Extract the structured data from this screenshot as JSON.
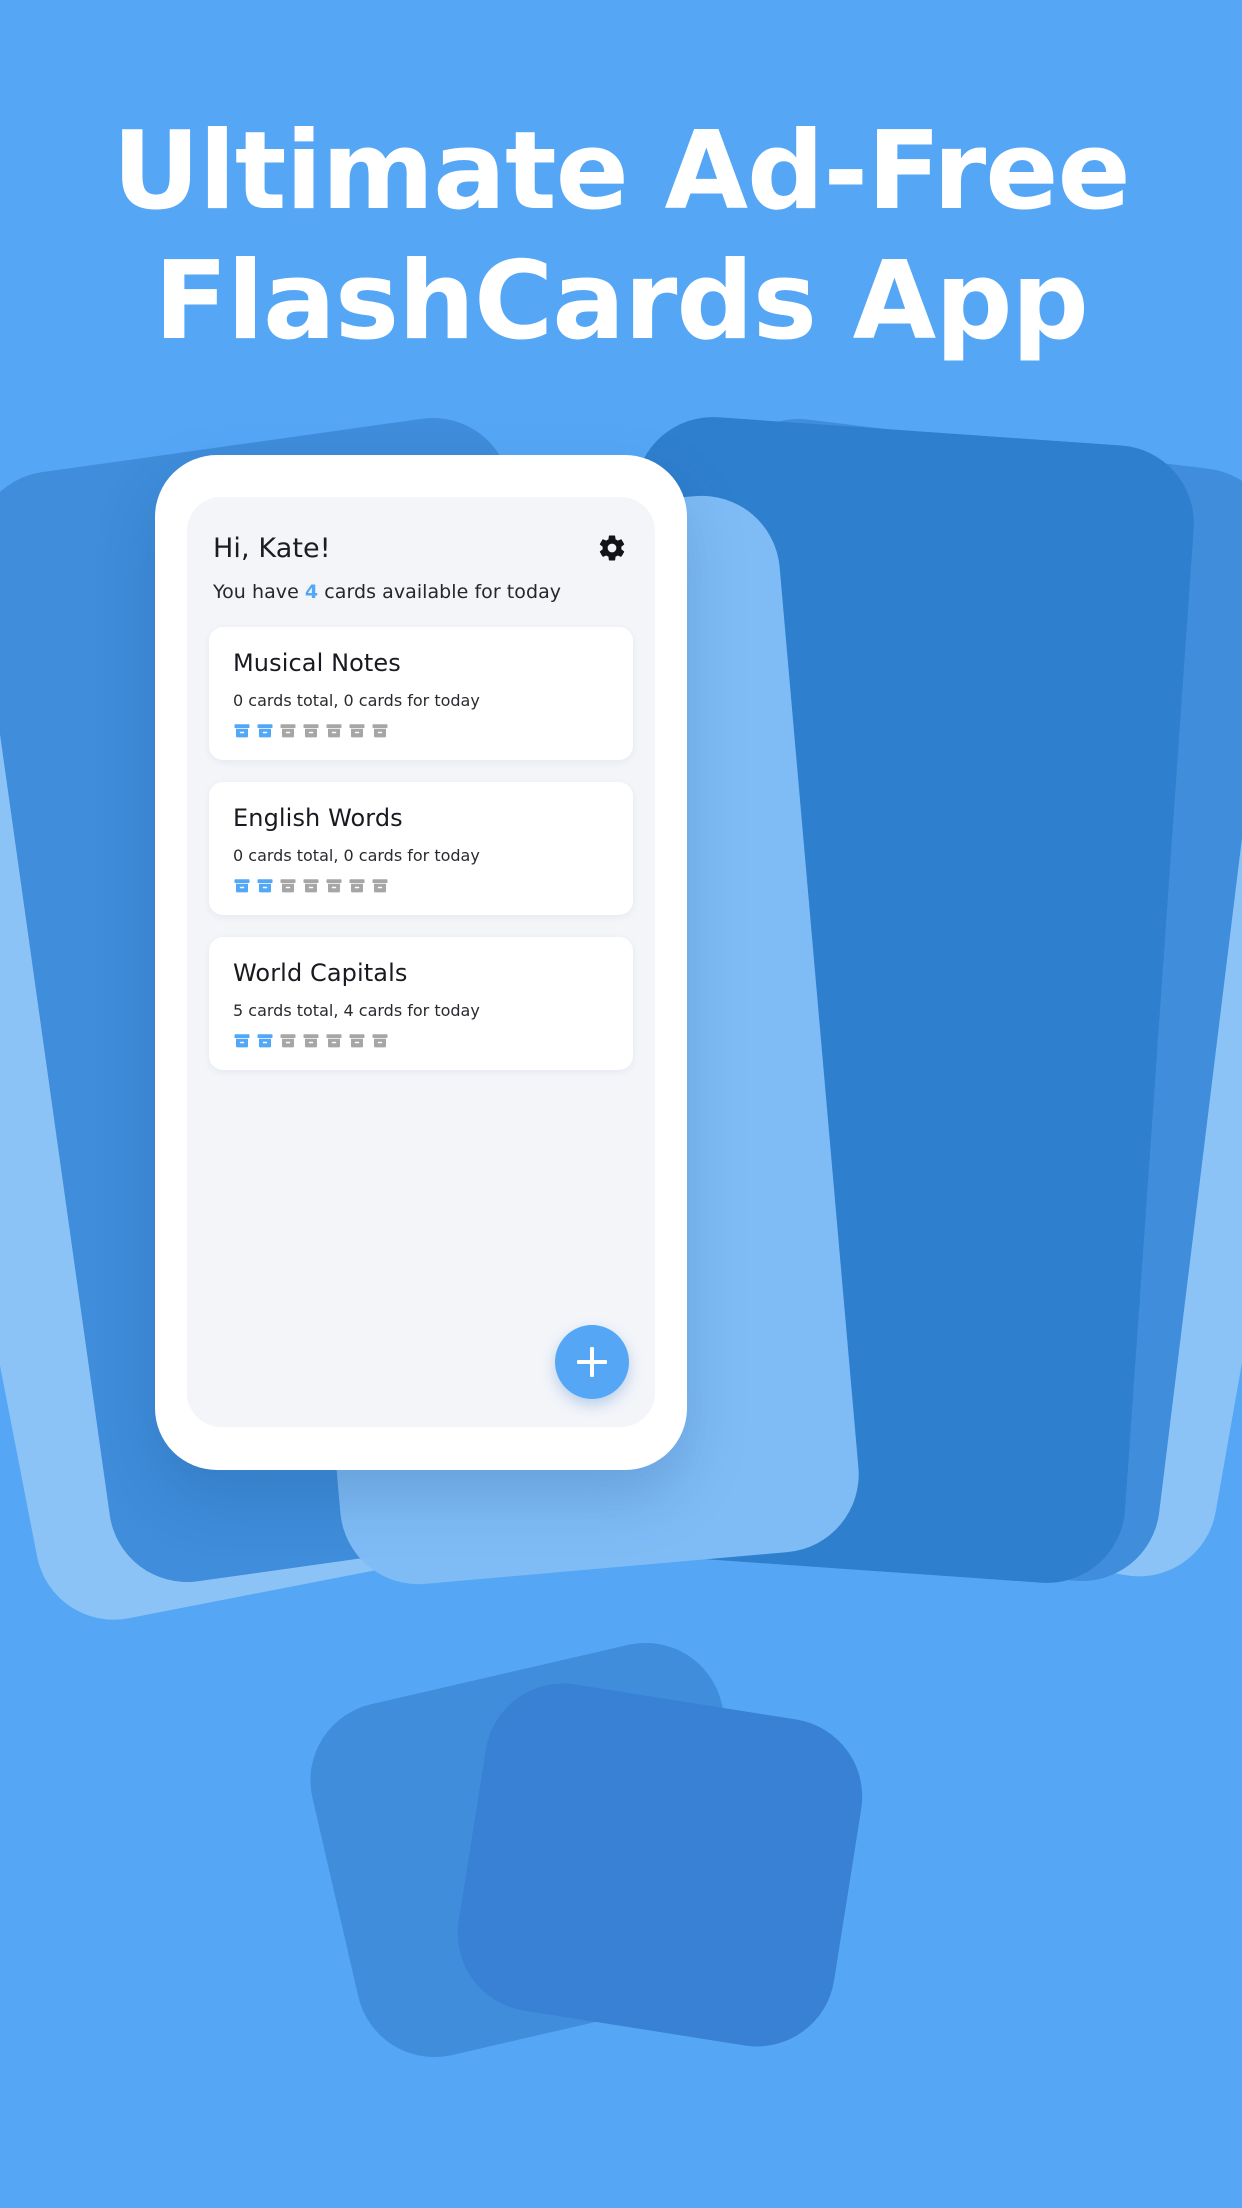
{
  "hero": {
    "line1": "Ultimate Ad-Free",
    "line2": "FlashCards App"
  },
  "colors": {
    "background": "#55a7f6",
    "accent": "#52a8f7",
    "phone_body": "#ffffff",
    "screen": "#f3f5f9",
    "card": "#ffffff",
    "box_active": "#52a8f7",
    "box_inactive": "#a6a6a6",
    "text_primary": "#191920",
    "shape_light": "#8cc3f7",
    "shape_mid": "#3f8ddb",
    "shape_dark": "#2f7fcf"
  },
  "app": {
    "greeting": "Hi, Kate!",
    "settings_icon": "gear-icon",
    "subtitle": {
      "prefix": "You have ",
      "count": "4",
      "suffix": " cards available for today"
    },
    "decks": [
      {
        "title": "Musical Notes",
        "stats": "0 cards total, 0 cards for today",
        "boxes_total": 7,
        "boxes_active": 2
      },
      {
        "title": "English Words",
        "stats": "0 cards total, 0 cards for today",
        "boxes_total": 7,
        "boxes_active": 2
      },
      {
        "title": "World Capitals",
        "stats": "5 cards total, 4 cards for today",
        "boxes_total": 7,
        "boxes_active": 2
      }
    ],
    "fab": {
      "icon": "plus-icon",
      "label": "Add deck"
    }
  }
}
